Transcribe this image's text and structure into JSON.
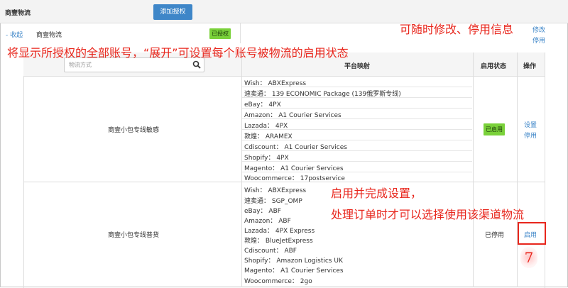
{
  "header": {
    "title": "商壹物流",
    "add_button": "添加授权"
  },
  "row": {
    "collapse": "- 收起",
    "name": "商壹物流",
    "auth_badge": "已授权",
    "edit": "修改",
    "disable": "停用"
  },
  "annotations": {
    "top_right": "可随时修改、停用信息",
    "top_left": "将显示所授权的全部账号，“展开”可设置每个账号被物流的启用状态",
    "mid_1": "启用并完成设置，",
    "mid_2": "处理订单时才可以选择使用该渠道物流",
    "step": "7"
  },
  "table": {
    "search_placeholder": "物流方式",
    "col_mapping": "平台映射",
    "col_status": "启用状态",
    "col_action": "操作",
    "rows": [
      {
        "name": "商壹小包专线敏感",
        "mappings": [
          "Wish： ABXExpress",
          "速卖通： 139 ECONOMIC Package (139俄罗斯专线)",
          "eBay： 4PX",
          "Amazon： A1 Courier Services",
          "Lazada： 4PX",
          "敦煌： ARAMEX",
          "Cdiscount： A1 Courier Services",
          "Shopify： 4PX",
          "Magento： A1 Courier Services",
          "Woocommerce： 17postservice"
        ],
        "status": "已启用",
        "action_1": "设置",
        "action_2": "停用"
      },
      {
        "name": "商壹小包专线普货",
        "mappings": [
          "Wish： ABXExpress",
          "速卖通： SGP_OMP",
          "eBay： ABF",
          "Amazon： ABF",
          "Lazada： 4PX Express",
          "敦煌： BlueJetExpress",
          "Cdiscount： ABF",
          "Shopify： Amazon Logistics UK",
          "Magento： A1 Courier Services",
          "Woocommerce： 2go"
        ],
        "status": "已停用",
        "action_1": "启用"
      }
    ]
  },
  "colors": {
    "accent": "#3e86c8",
    "success": "#7ad13a",
    "annotation": "#e8261c"
  }
}
